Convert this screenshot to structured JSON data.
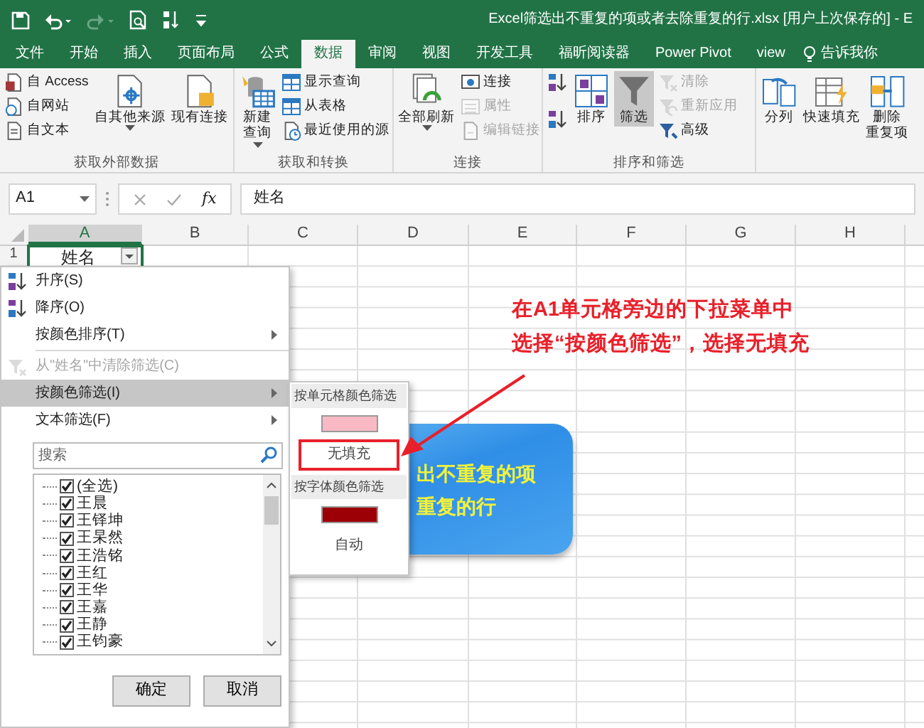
{
  "title_bar": {
    "title": "Excel筛选出不重复的项或者去除重复的行.xlsx [用户上次保存的]  -  E"
  },
  "tabs": [
    {
      "label": "文件",
      "selected": false
    },
    {
      "label": "开始",
      "selected": false
    },
    {
      "label": "插入",
      "selected": false
    },
    {
      "label": "页面布局",
      "selected": false
    },
    {
      "label": "公式",
      "selected": false
    },
    {
      "label": "数据",
      "selected": true
    },
    {
      "label": "审阅",
      "selected": false
    },
    {
      "label": "视图",
      "selected": false
    },
    {
      "label": "开发工具",
      "selected": false
    },
    {
      "label": "福昕阅读器",
      "selected": false
    },
    {
      "label": "Power Pivot",
      "selected": false
    },
    {
      "label": "view",
      "selected": false
    }
  ],
  "tell_me": {
    "text": "告诉我你"
  },
  "ribbon": {
    "groups": [
      {
        "label": "获取外部数据",
        "columns": [
          {
            "items": [
              {
                "kind": "small",
                "label": "自 Access",
                "disabled": false,
                "pressed": false,
                "dropdown": false
              },
              {
                "kind": "small",
                "label": "自网站",
                "disabled": false,
                "pressed": false,
                "dropdown": false
              },
              {
                "kind": "small",
                "label": "自文本",
                "disabled": false,
                "pressed": false,
                "dropdown": false
              }
            ]
          },
          {
            "items": [
              {
                "kind": "large",
                "label": "自其他来源",
                "disabled": false,
                "pressed": false,
                "dropdown": true
              }
            ]
          },
          {
            "items": [
              {
                "kind": "large",
                "label": "现有连接",
                "disabled": false,
                "pressed": false,
                "dropdown": false
              }
            ]
          }
        ]
      },
      {
        "label": "获取和转换",
        "columns": [
          {
            "items": [
              {
                "kind": "large",
                "lines": [
                  "新建",
                  "查询"
                ],
                "disabled": false,
                "pressed": false,
                "dropdown": true
              }
            ]
          },
          {
            "items": [
              {
                "kind": "small",
                "label": "显示查询",
                "disabled": false,
                "pressed": false,
                "dropdown": false
              },
              {
                "kind": "small",
                "label": "从表格",
                "disabled": false,
                "pressed": false,
                "dropdown": false
              },
              {
                "kind": "small",
                "label": "最近使用的源",
                "disabled": false,
                "pressed": false,
                "dropdown": false
              }
            ]
          }
        ]
      },
      {
        "label": "连接",
        "columns": [
          {
            "items": [
              {
                "kind": "large",
                "label": "全部刷新",
                "disabled": false,
                "pressed": false,
                "dropdown": true
              }
            ]
          },
          {
            "items": [
              {
                "kind": "small",
                "label": "连接",
                "disabled": false,
                "pressed": false,
                "dropdown": false
              },
              {
                "kind": "small",
                "label": "属性",
                "disabled": true,
                "pressed": false,
                "dropdown": false
              },
              {
                "kind": "small",
                "label": "编辑链接",
                "disabled": true,
                "pressed": false,
                "dropdown": false
              }
            ]
          }
        ]
      },
      {
        "label": "排序和筛选",
        "columns": [
          {
            "items": [
              {
                "kind": "icon",
                "disabled": false,
                "pressed": false,
                "dropdown": false
              },
              {
                "kind": "icon",
                "disabled": false,
                "pressed": false,
                "dropdown": false
              }
            ]
          },
          {
            "items": [
              {
                "kind": "large",
                "label": "排序",
                "disabled": false,
                "pressed": false,
                "dropdown": false
              }
            ]
          },
          {
            "items": [
              {
                "kind": "large",
                "label": "筛选",
                "disabled": false,
                "pressed": true,
                "dropdown": false
              }
            ]
          },
          {
            "items": [
              {
                "kind": "small",
                "label": "清除",
                "disabled": true,
                "pressed": false,
                "dropdown": false
              },
              {
                "kind": "small",
                "label": "重新应用",
                "disabled": true,
                "pressed": false,
                "dropdown": false
              },
              {
                "kind": "small",
                "label": "高级",
                "disabled": false,
                "pressed": false,
                "dropdown": false
              }
            ]
          }
        ]
      },
      {
        "columns": [
          {
            "items": [
              {
                "kind": "large",
                "label": "分列",
                "disabled": false,
                "pressed": false,
                "dropdown": false
              }
            ]
          },
          {
            "items": [
              {
                "kind": "large",
                "label": "快速填充",
                "disabled": false,
                "pressed": false,
                "dropdown": false
              }
            ]
          },
          {
            "items": [
              {
                "kind": "large",
                "lines": [
                  "删除",
                  "重复项"
                ],
                "disabled": false,
                "pressed": false,
                "dropdown": false
              }
            ]
          }
        ]
      }
    ]
  },
  "formula_bar": {
    "name_box": "A1",
    "function_label": "fx",
    "formula": "姓名"
  },
  "sheet": {
    "columns": [
      {
        "label": "A",
        "selected": true
      },
      {
        "label": "B",
        "selected": false
      },
      {
        "label": "C",
        "selected": false
      },
      {
        "label": "D",
        "selected": false
      },
      {
        "label": "E",
        "selected": false
      },
      {
        "label": "F",
        "selected": false
      },
      {
        "label": "G",
        "selected": false
      },
      {
        "label": "H",
        "selected": false
      }
    ],
    "rows": [
      {
        "header": "1",
        "cells": [
          "姓名"
        ]
      }
    ]
  },
  "filter_menu": {
    "items": [
      {
        "kind": "command",
        "label": "升序(S)",
        "disabled": false,
        "selected": false,
        "submenu": false
      },
      {
        "kind": "command",
        "label": "降序(O)",
        "disabled": false,
        "selected": false,
        "submenu": false
      },
      {
        "kind": "command",
        "label": "按颜色排序(T)",
        "disabled": false,
        "selected": false,
        "submenu": true
      },
      {
        "kind": "separator"
      },
      {
        "kind": "command",
        "label": "从\"姓名\"中清除筛选(C)",
        "disabled": true,
        "selected": false,
        "submenu": false
      },
      {
        "kind": "command",
        "label": "按颜色筛选(I)",
        "disabled": false,
        "selected": true,
        "submenu": true
      },
      {
        "kind": "command",
        "label": "文本筛选(F)",
        "disabled": false,
        "selected": false,
        "submenu": true
      }
    ],
    "search": {
      "placeholder": "搜索"
    },
    "values": [
      {
        "label": "(全选)",
        "checked": true
      },
      {
        "label": "王晨",
        "checked": true
      },
      {
        "label": "王铎坤",
        "checked": true
      },
      {
        "label": "王杲然",
        "checked": true
      },
      {
        "label": "王浩铭",
        "checked": true
      },
      {
        "label": "王红",
        "checked": true
      },
      {
        "label": "王华",
        "checked": true
      },
      {
        "label": "王嘉",
        "checked": true
      },
      {
        "label": "王静",
        "checked": true
      },
      {
        "label": "王钧豪",
        "checked": true
      }
    ],
    "buttons": [
      "确定",
      "取消"
    ]
  },
  "color_submenu": {
    "items": [
      {
        "kind": "header",
        "label": "按单元格颜色筛选"
      },
      {
        "kind": "swatch",
        "color": "#f8b9c4"
      },
      {
        "kind": "option",
        "label": "无填充",
        "highlighted": true
      },
      {
        "kind": "header",
        "label": "按字体颜色筛选"
      },
      {
        "kind": "swatch",
        "color": "#9c0006"
      },
      {
        "kind": "option",
        "label": "自动",
        "highlighted": false
      }
    ]
  },
  "callout_shape": {
    "lines": [
      "出不重复的项",
      "重复的行"
    ]
  },
  "annotation": {
    "lines": [
      "在A1单元格旁边的下拉菜单中",
      "选择“按颜色筛选”，选择无填充"
    ]
  }
}
